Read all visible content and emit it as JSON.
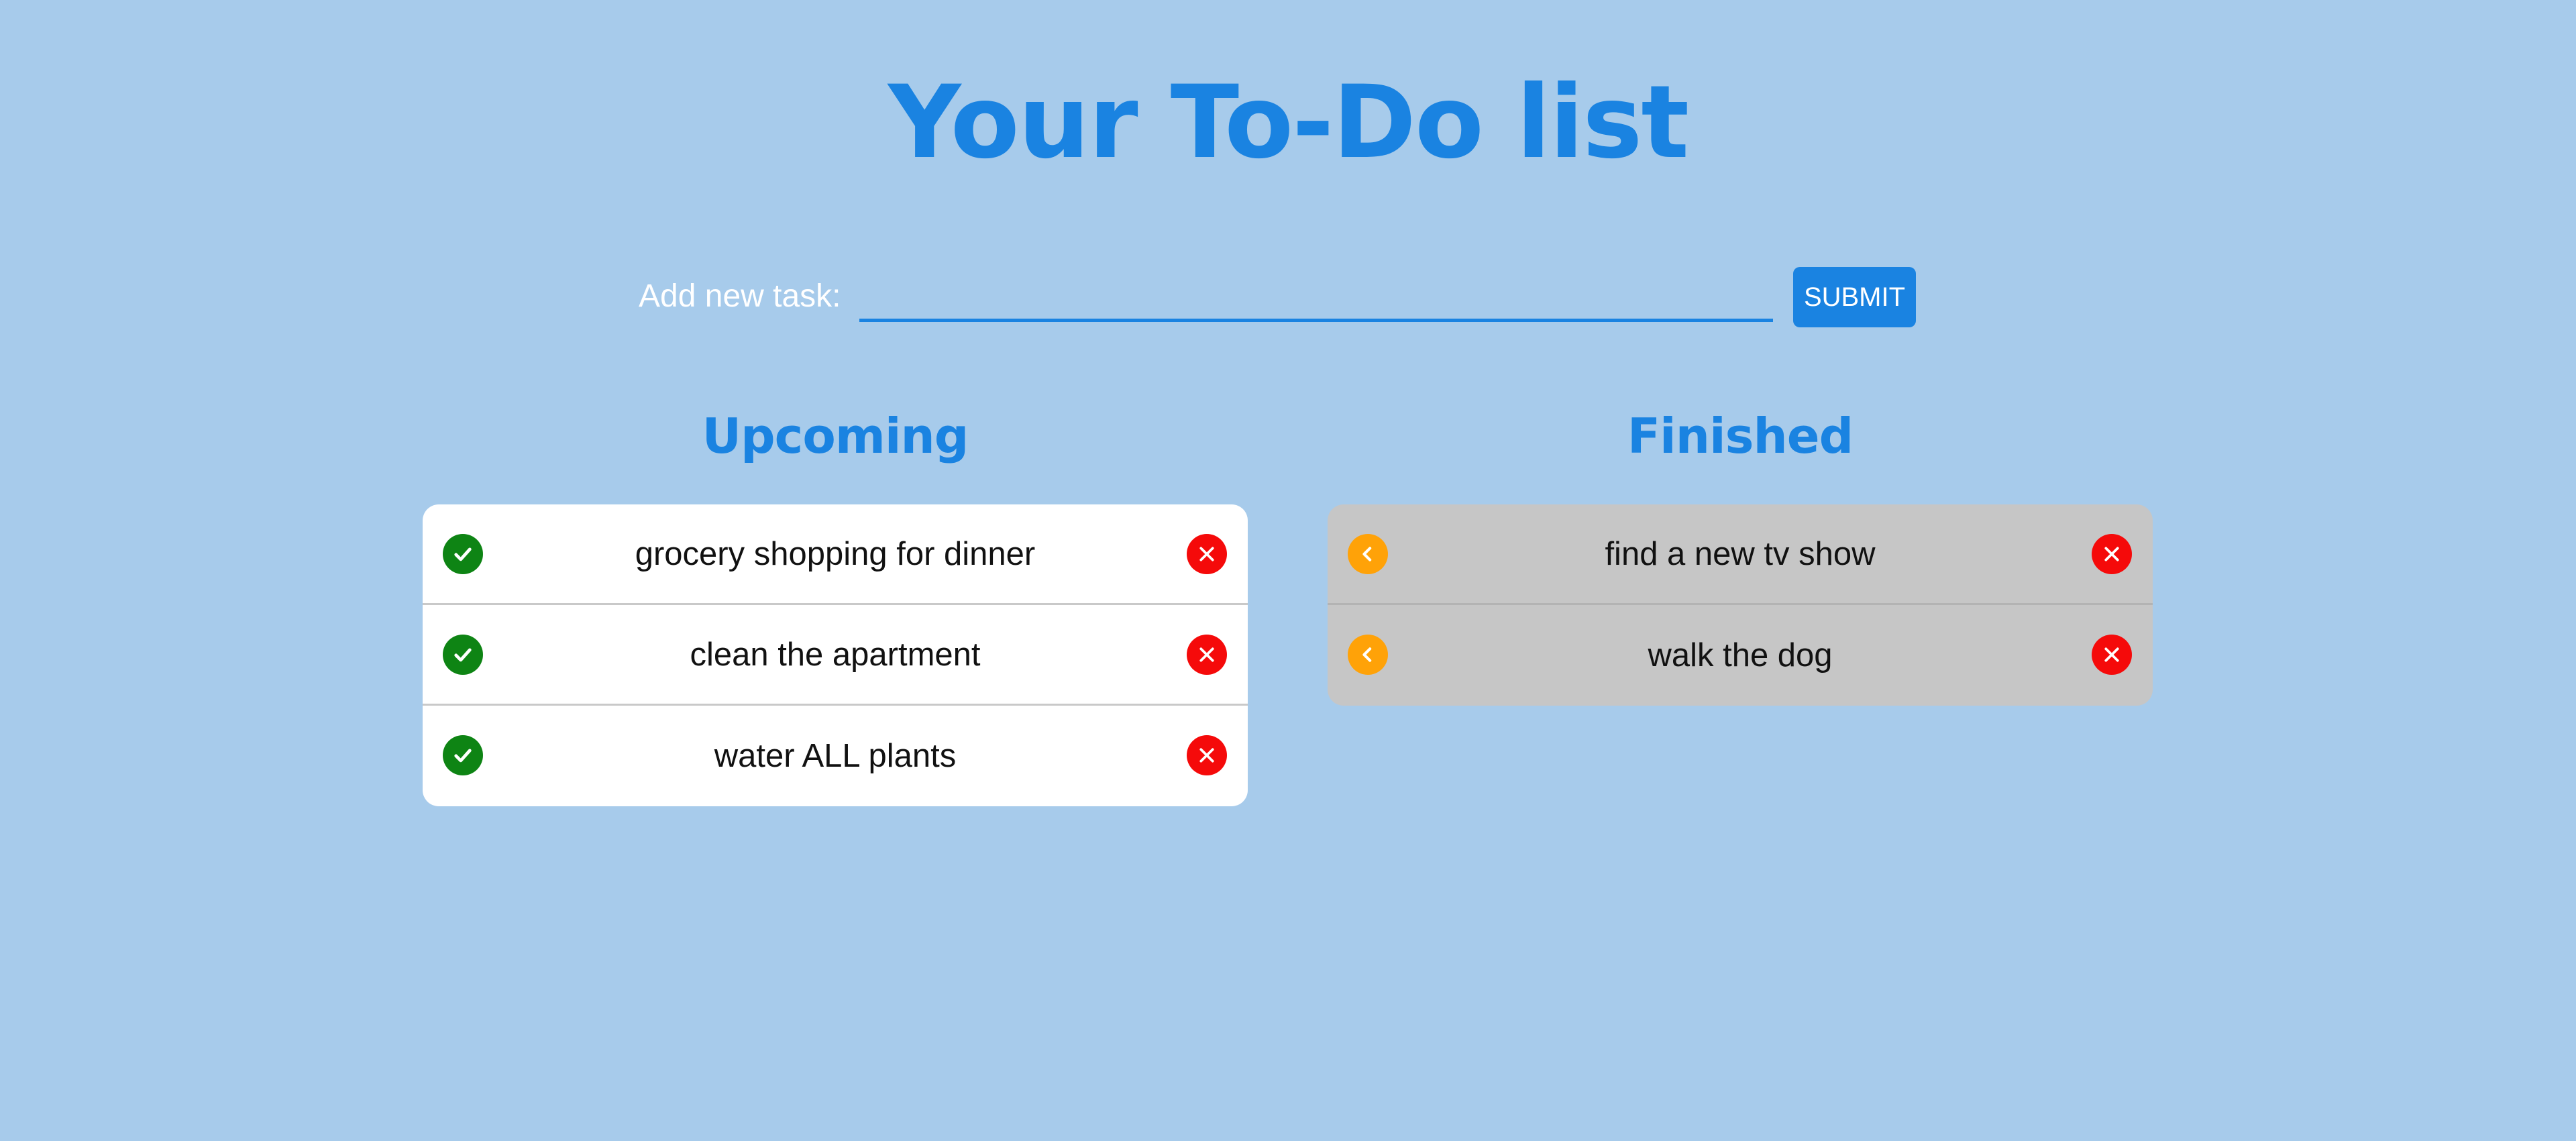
{
  "title": "Your To-Do list",
  "add_task": {
    "label": "Add new task:",
    "input_value": "",
    "submit_label": "SUBMIT"
  },
  "upcoming": {
    "heading": "Upcoming",
    "tasks": [
      "grocery shopping for dinner",
      "clean the apartment",
      "water ALL plants"
    ]
  },
  "finished": {
    "heading": "Finished",
    "tasks": [
      "find a new tv show",
      "walk the dog"
    ]
  },
  "icons": {
    "complete": "check-circle-icon",
    "restore": "chevron-left-circle-icon",
    "delete": "x-circle-icon"
  },
  "colors": {
    "background": "#a7cbeb",
    "accent": "#1a83e1",
    "complete": "#0e8414",
    "restore": "#ffa208",
    "delete": "#f50a0a",
    "finished_panel": "#c6c6c6"
  }
}
